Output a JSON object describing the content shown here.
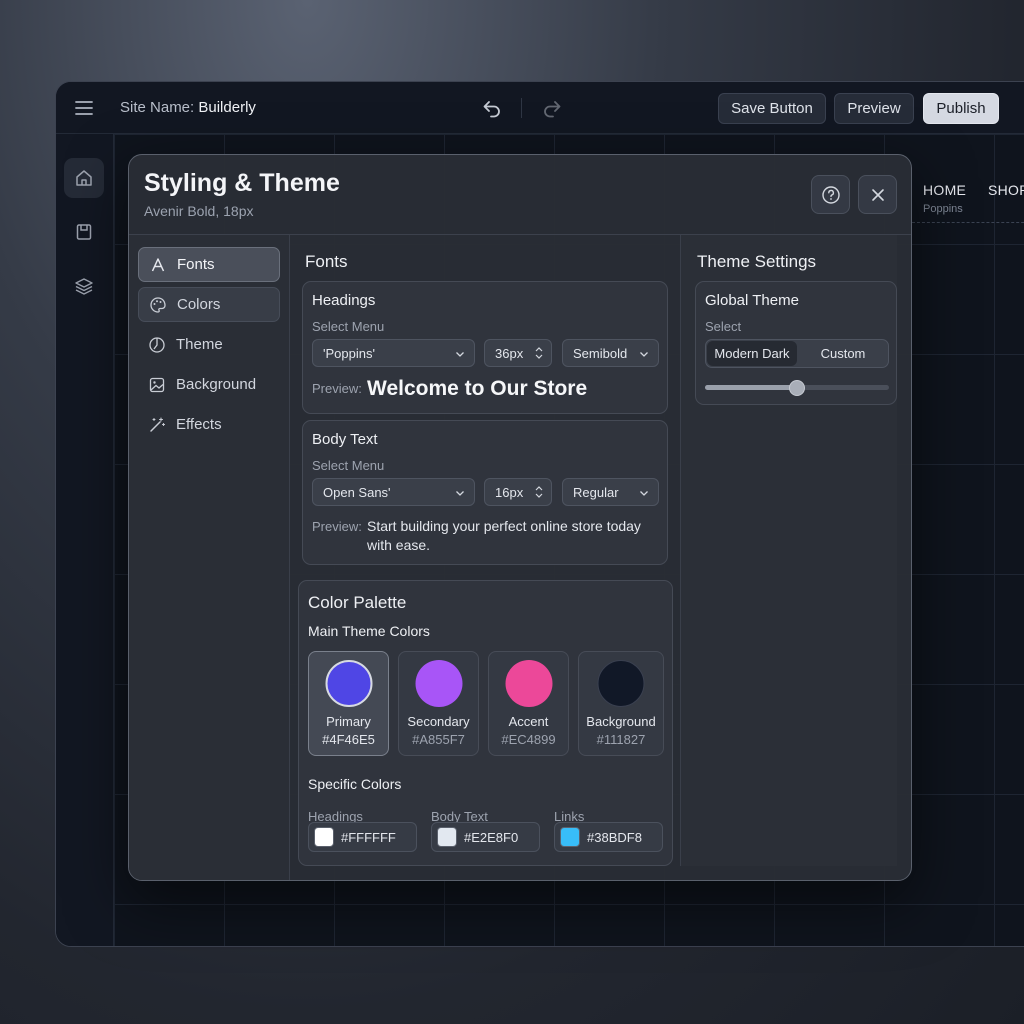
{
  "topbar": {
    "site_label": "Site Name: ",
    "site_name": "Builderly",
    "save_label": "Save Button",
    "preview_label": "Preview",
    "publish_label": "Publish"
  },
  "rail": {
    "icons": [
      "home-icon",
      "page-icon",
      "layers-icon"
    ]
  },
  "canvas_nav": {
    "home": "HOME",
    "home_font": "Poppins",
    "shop": "SHOP"
  },
  "modal": {
    "title": "Styling & Theme",
    "subtitle": "Avenir Bold, 18px",
    "nav": [
      {
        "label": "Fonts",
        "icon": "font-icon",
        "active": true
      },
      {
        "label": "Colors",
        "icon": "palette-icon"
      },
      {
        "label": "Theme",
        "icon": "theme-icon"
      },
      {
        "label": "Background",
        "icon": "image-icon"
      },
      {
        "label": "Effects",
        "icon": "magic-wand-icon"
      }
    ]
  },
  "fonts": {
    "title": "Fonts",
    "headings": {
      "title": "Headings",
      "select_label": "Select Menu",
      "family": "'Poppins'",
      "size": "36px",
      "weight": "Semibold",
      "preview_label": "Preview:",
      "preview_text": "Welcome to Our Store"
    },
    "body": {
      "title": "Body Text",
      "select_label": "Select Menu",
      "family": "Open Sans'",
      "size": "16px",
      "weight": "Regular",
      "preview_label": "Preview:",
      "preview_text": "Start building your perfect online store today with ease."
    }
  },
  "palette": {
    "title": "Color Palette",
    "main_title": "Main Theme Colors",
    "swatches": [
      {
        "name": "Primary",
        "hex": "#4F46E5",
        "selected": true
      },
      {
        "name": "Secondary",
        "hex": "#A855F7"
      },
      {
        "name": "Accent",
        "hex": "#EC4899"
      },
      {
        "name": "Background",
        "hex": "#111827"
      }
    ],
    "specific_title": "Specific Colors",
    "specific": [
      {
        "label": "Headings",
        "hex": "#FFFFFF"
      },
      {
        "label": "Body Text",
        "hex": "#E2E8F0"
      },
      {
        "label": "Links",
        "hex": "#38BDF8"
      }
    ]
  },
  "theme_settings": {
    "title": "Theme Settings",
    "global_title": "Global Theme",
    "select_label": "Select",
    "options": [
      "Modern Dark",
      "Custom"
    ],
    "selected": "Modern Dark",
    "slider_value": 0.5
  }
}
